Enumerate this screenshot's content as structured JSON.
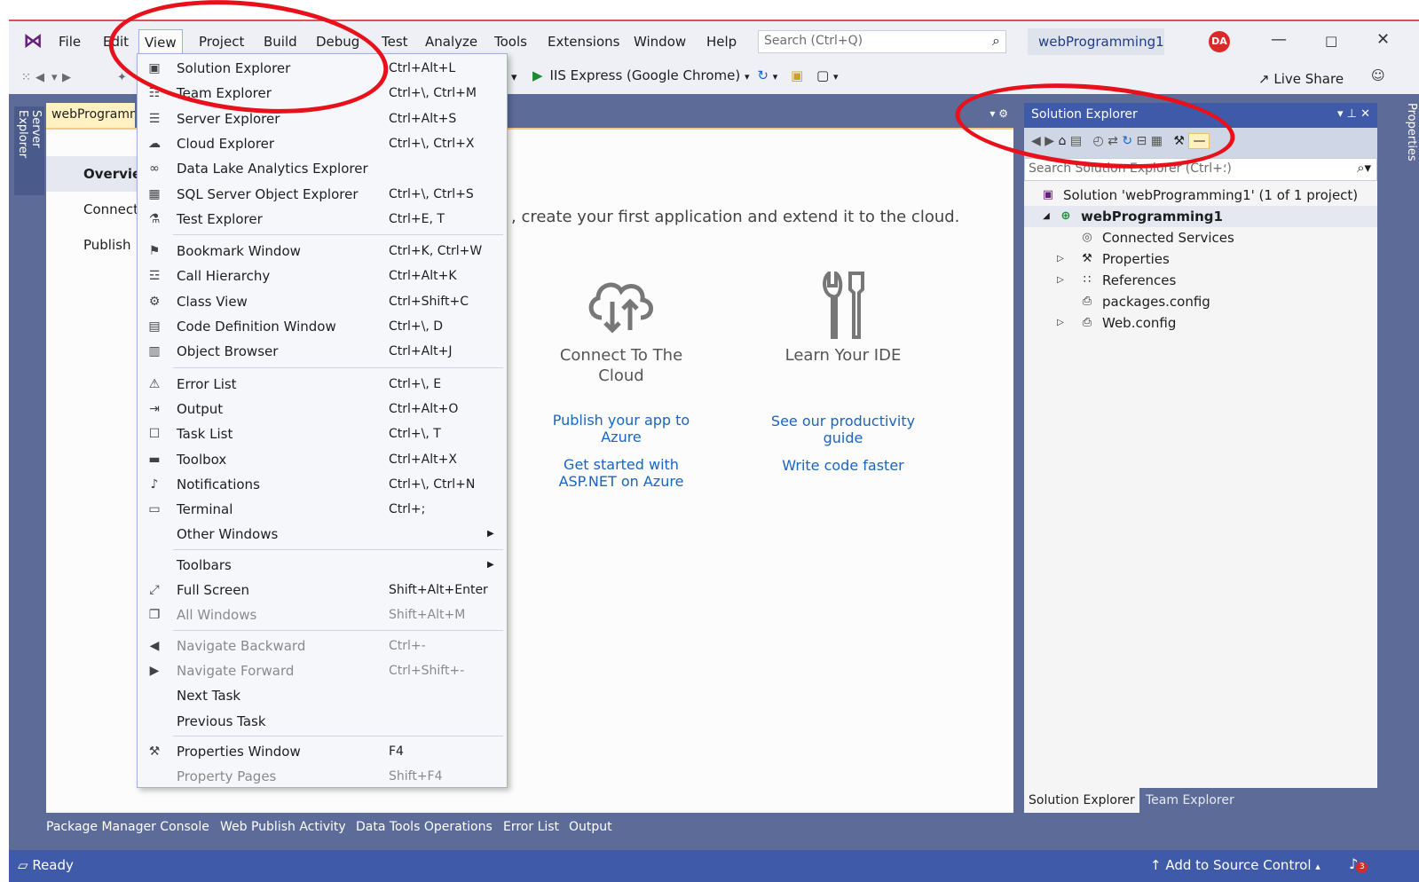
{
  "menubar": {
    "items": [
      "File",
      "Edit",
      "View",
      "Project",
      "Build",
      "Debug",
      "Test",
      "Analyze",
      "Tools",
      "Extensions",
      "Window",
      "Help"
    ],
    "search_placeholder": "Search (Ctrl+Q)",
    "solution_name": "webProgramming1",
    "avatar_initials": "DA"
  },
  "toolbar": {
    "run_target": "IIS Express (Google Chrome)",
    "live_share": "Live Share"
  },
  "view_menu": {
    "items": [
      {
        "label": "Solution Explorer",
        "shortcut": "Ctrl+Alt+L",
        "icon": "solution-explorer-icon"
      },
      {
        "label": "Team Explorer",
        "shortcut": "Ctrl+\\, Ctrl+M",
        "icon": "team-explorer-icon"
      },
      {
        "label": "Server Explorer",
        "shortcut": "Ctrl+Alt+S",
        "icon": "server-icon"
      },
      {
        "label": "Cloud Explorer",
        "shortcut": "Ctrl+\\, Ctrl+X",
        "icon": "cloud-icon"
      },
      {
        "label": "Data Lake Analytics Explorer",
        "shortcut": "",
        "icon": "binoculars-icon"
      },
      {
        "label": "SQL Server Object Explorer",
        "shortcut": "Ctrl+\\, Ctrl+S",
        "icon": "sql-server-icon"
      },
      {
        "label": "Test Explorer",
        "shortcut": "Ctrl+E, T",
        "icon": "test-explorer-icon"
      },
      {
        "label": "Bookmark Window",
        "shortcut": "Ctrl+K, Ctrl+W",
        "icon": "bookmark-icon"
      },
      {
        "label": "Call Hierarchy",
        "shortcut": "Ctrl+Alt+K",
        "icon": "call-hierarchy-icon"
      },
      {
        "label": "Class View",
        "shortcut": "Ctrl+Shift+C",
        "icon": "class-view-icon"
      },
      {
        "label": "Code Definition Window",
        "shortcut": "Ctrl+\\, D",
        "icon": "code-definition-icon"
      },
      {
        "label": "Object Browser",
        "shortcut": "Ctrl+Alt+J",
        "icon": "object-browser-icon"
      },
      {
        "label": "Error List",
        "shortcut": "Ctrl+\\, E",
        "icon": "error-list-icon"
      },
      {
        "label": "Output",
        "shortcut": "Ctrl+Alt+O",
        "icon": "output-icon"
      },
      {
        "label": "Task List",
        "shortcut": "Ctrl+\\, T",
        "icon": "task-list-icon"
      },
      {
        "label": "Toolbox",
        "shortcut": "Ctrl+Alt+X",
        "icon": "toolbox-icon"
      },
      {
        "label": "Notifications",
        "shortcut": "Ctrl+\\, Ctrl+N",
        "icon": "bell-icon"
      },
      {
        "label": "Terminal",
        "shortcut": "Ctrl+;",
        "icon": "terminal-icon"
      },
      {
        "label": "Other Windows",
        "shortcut": "",
        "icon": ""
      },
      {
        "label": "Toolbars",
        "shortcut": "",
        "icon": ""
      },
      {
        "label": "Full Screen",
        "shortcut": "Shift+Alt+Enter",
        "icon": "full-screen-icon"
      },
      {
        "label": "All Windows",
        "shortcut": "Shift+Alt+M",
        "icon": "all-windows-icon"
      },
      {
        "label": "Navigate Backward",
        "shortcut": "Ctrl+-",
        "icon": "navigate-back-icon"
      },
      {
        "label": "Navigate Forward",
        "shortcut": "Ctrl+Shift+-",
        "icon": "navigate-forward-icon"
      },
      {
        "label": "Next Task",
        "shortcut": "",
        "icon": ""
      },
      {
        "label": "Previous Task",
        "shortcut": "",
        "icon": ""
      },
      {
        "label": "Properties Window",
        "shortcut": "F4",
        "icon": "wrench-icon"
      },
      {
        "label": "Property Pages",
        "shortcut": "Shift+F4",
        "icon": ""
      }
    ]
  },
  "side_tabs": {
    "left": "Server Explorer",
    "right": "Properties"
  },
  "document": {
    "tab_label": "webProgramm",
    "nav": [
      "Overview",
      "Connected",
      "Publish"
    ],
    "tagline": ", create your first application and extend it to the cloud.",
    "cards": [
      {
        "title_line1": "Connect To The",
        "title_line2": "Cloud",
        "link1_l1": "Publish your app to",
        "link1_l2": "Azure",
        "link2_l1": "Get started with",
        "link2_l2": "ASP.NET on Azure"
      },
      {
        "title_line1": "Learn Your IDE",
        "title_line2": "",
        "link1_l1": "See our productivity",
        "link1_l2": "guide",
        "link2_l1": "Write code faster",
        "link2_l2": ""
      }
    ]
  },
  "solution_explorer": {
    "title": "Solution Explorer",
    "search_placeholder": "Search Solution Explorer (Ctrl+؛)",
    "tree": [
      {
        "label": "Solution 'webProgramming1' (1 of 1 project)",
        "icon": "solution-icon",
        "expander": ""
      },
      {
        "label": "webProgramming1",
        "icon": "web-project-icon",
        "expander": "◢"
      },
      {
        "label": "Connected Services",
        "icon": "connected-services-icon",
        "expander": ""
      },
      {
        "label": "Properties",
        "icon": "wrench-icon",
        "expander": "▷"
      },
      {
        "label": "References",
        "icon": "references-icon",
        "expander": "▷"
      },
      {
        "label": "packages.config",
        "icon": "config-file-icon",
        "expander": ""
      },
      {
        "label": "Web.config",
        "icon": "config-file-icon",
        "expander": "▷"
      }
    ],
    "tabs": [
      "Solution Explorer",
      "Team Explorer"
    ]
  },
  "bottom_tabs": [
    "Package Manager Console",
    "Web Publish Activity",
    "Data Tools Operations",
    "Error List",
    "Output"
  ],
  "status": {
    "ready": "Ready",
    "source_control": "Add to Source Control",
    "notification_count": "3"
  },
  "colors": {
    "accent": "#3e5aa8",
    "chrome": "#5d6b99",
    "annotation": "#e8101b"
  }
}
